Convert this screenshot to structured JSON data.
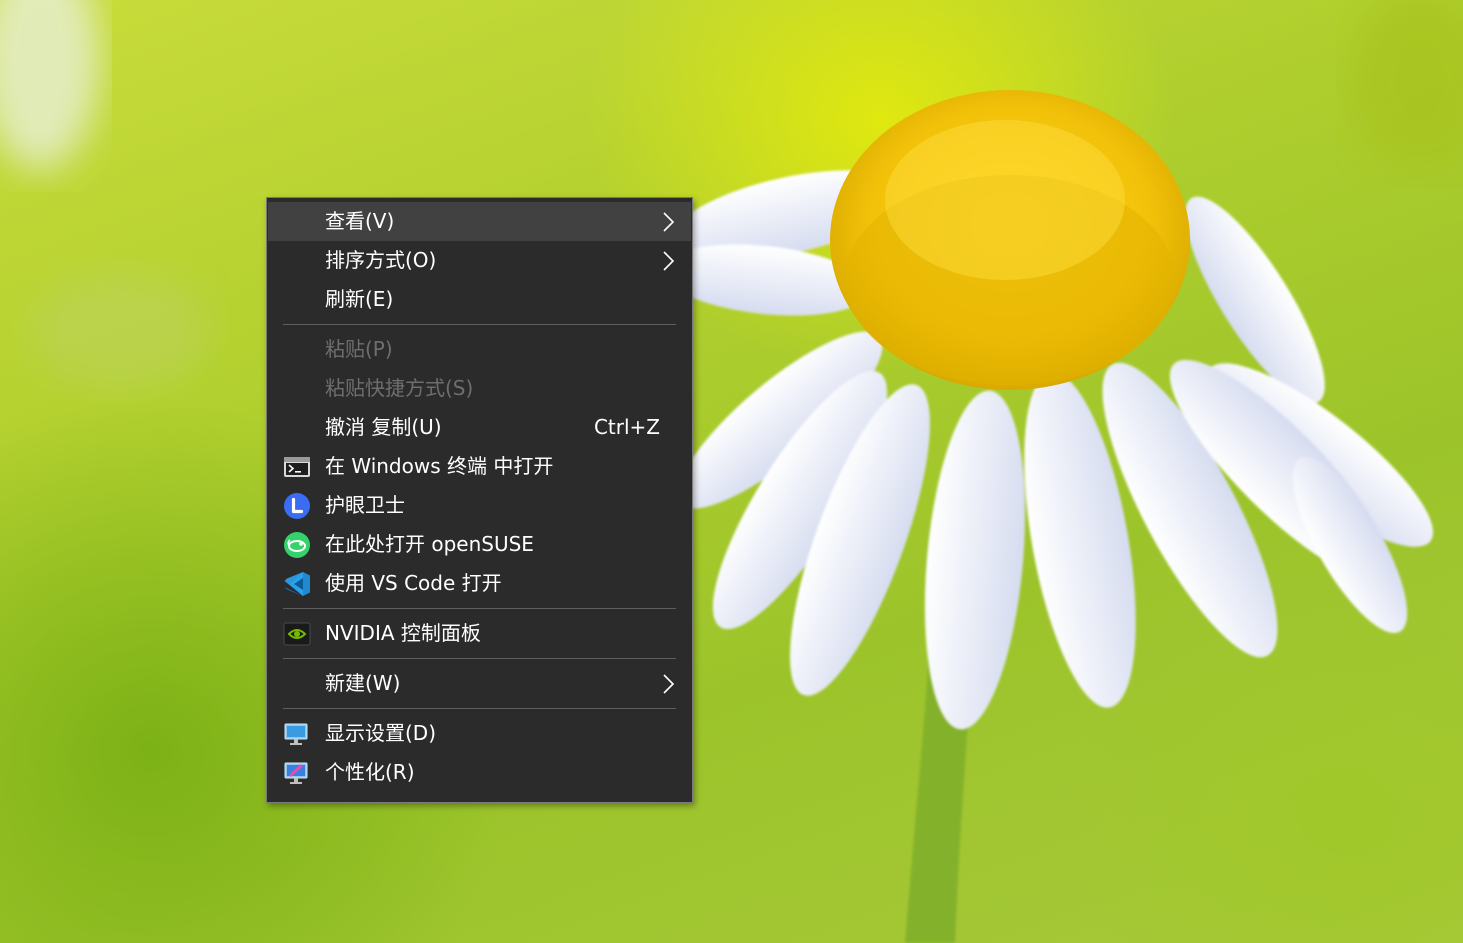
{
  "context_menu": {
    "items": [
      {
        "label": "查看(V)",
        "submenu": true,
        "highlighted": true
      },
      {
        "label": "排序方式(O)",
        "submenu": true
      },
      {
        "label": "刷新(E)"
      },
      {
        "label": "粘贴(P)",
        "disabled": true
      },
      {
        "label": "粘贴快捷方式(S)",
        "disabled": true
      },
      {
        "label": "撤消 复制(U)",
        "shortcut": "Ctrl+Z"
      },
      {
        "label": "在 Windows 终端 中打开",
        "icon": "windows-terminal-icon"
      },
      {
        "label": "护眼卫士",
        "icon": "eye-guard-app-icon"
      },
      {
        "label": "在此处打开 openSUSE",
        "icon": "opensuse-icon"
      },
      {
        "label": "使用 VS Code 打开",
        "icon": "vscode-icon"
      },
      {
        "label": "NVIDIA 控制面板",
        "icon": "nvidia-icon"
      },
      {
        "label": "新建(W)",
        "submenu": true
      },
      {
        "label": "显示设置(D)",
        "icon": "display-settings-icon"
      },
      {
        "label": "个性化(R)",
        "icon": "personalize-icon"
      }
    ]
  },
  "colors": {
    "menu_background": "#2b2b2b",
    "menu_highlight": "#414141",
    "menu_text": "#ffffff",
    "menu_disabled_text": "#6e6e6e",
    "separator": "#5e5e5e"
  }
}
